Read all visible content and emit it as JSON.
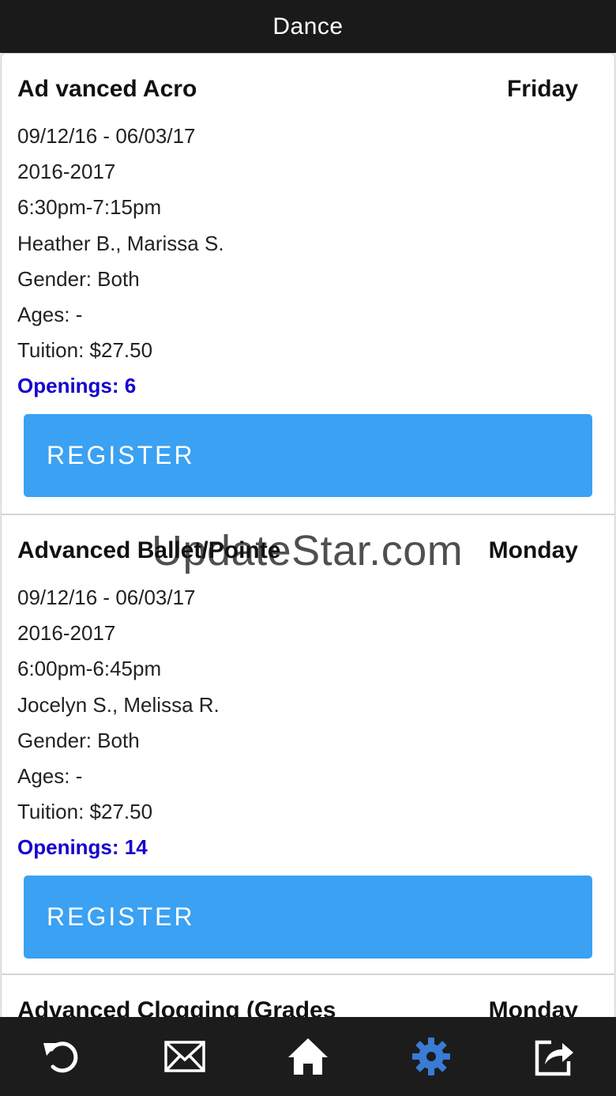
{
  "header": {
    "title": "Dance"
  },
  "classes": [
    {
      "name": "Ad vanced Acro",
      "day": "Friday",
      "dates": "09/12/16 - 06/03/17",
      "season": "2016-2017",
      "time": "6:30pm-7:15pm",
      "instructors": "Heather B., Marissa S.",
      "gender": "Gender: Both",
      "ages": "Ages: -",
      "tuition": "Tuition: $27.50",
      "openings": "Openings: 6",
      "register_label": "REGISTER"
    },
    {
      "name": "Advanced Ballet/Pointe",
      "day": "Monday",
      "dates": "09/12/16 - 06/03/17",
      "season": "2016-2017",
      "time": "6:00pm-6:45pm",
      "instructors": "Jocelyn S., Melissa R.",
      "gender": "Gender: Both",
      "ages": "Ages: -",
      "tuition": "Tuition: $27.50",
      "openings": "Openings: 14",
      "register_label": "REGISTER"
    },
    {
      "name": "Advanced Clogging (Grades",
      "day": "Monday"
    }
  ],
  "watermark": "UpdateStar.com",
  "bottom_nav": [
    {
      "icon": "undo-icon"
    },
    {
      "icon": "mail-icon"
    },
    {
      "icon": "home-icon"
    },
    {
      "icon": "gear-icon"
    },
    {
      "icon": "share-icon"
    }
  ],
  "colors": {
    "topbar": "#1a1a1a",
    "register_button": "#3aa1f3",
    "openings_text": "#1500cf",
    "active_tab": "#3a7bd5",
    "tab_icon": "#ffffff"
  }
}
